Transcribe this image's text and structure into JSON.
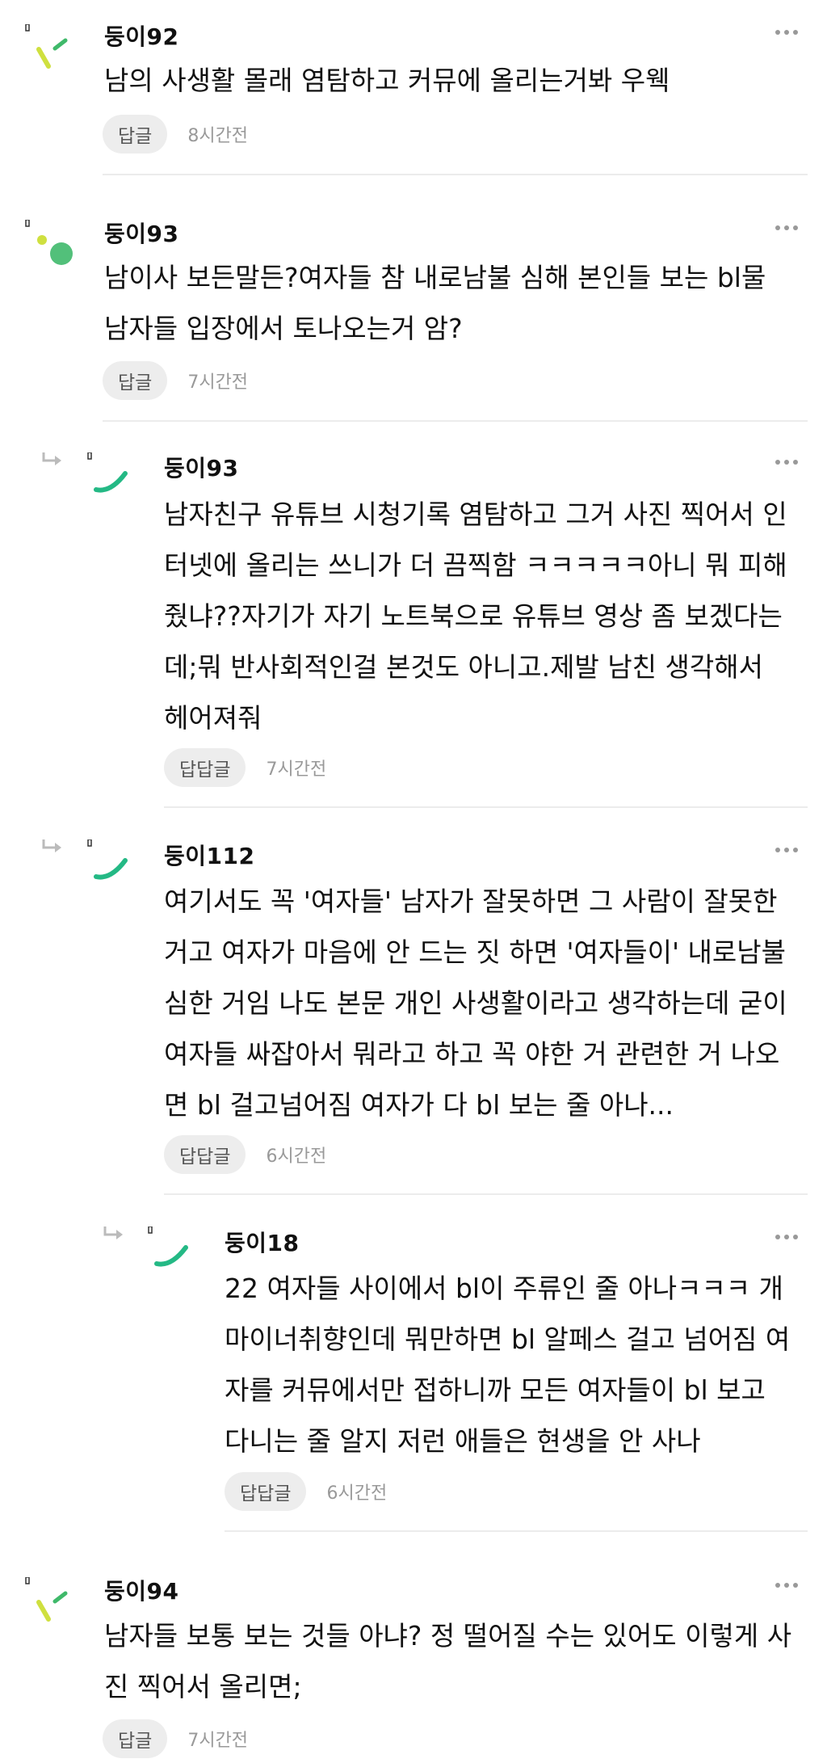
{
  "comments": [
    {
      "nickname": "둥이92",
      "text": "남의 사생활 몰래 염탐하고 커뮤에 올리는거봐 우웩",
      "reply_label": "답글",
      "time": "8시간전"
    },
    {
      "nickname": "둥이93",
      "text": "남이사 보든말든?여자들 참 내로남불 심해 본인들 보는 bl물 남자들 입장에서 토나오는거 암?",
      "reply_label": "답글",
      "time": "7시간전"
    },
    {
      "nickname": "둥이93",
      "text": "남자친구 유튜브 시청기록 염탐하고 그거 사진 찍어서 인터넷에 올리는 쓰니가 더 끔찍함 ㅋㅋㅋㅋㅋ아니 뭐 피해줬냐??자기가 자기 노트북으로 유튜브 영상 좀 보겠다는데;뭐 반사회적인걸 본것도 아니고.제발 남친 생각해서 헤어져줘",
      "reply_label": "답답글",
      "time": "7시간전"
    },
    {
      "nickname": "둥이112",
      "text": "여기서도 꼭 '여자들' 남자가 잘못하면 그 사람이 잘못한 거고 여자가 마음에 안 드는 짓 하면 '여자들이' 내로남불 심한 거임 나도 본문 개인 사생활이라고 생각하는데 굳이 여자들 싸잡아서 뭐라고 하고 꼭 야한 거 관련한 거 나오면 bl 걸고넘어짐 여자가 다 bl 보는 줄 아나...",
      "reply_label": "답답글",
      "time": "6시간전"
    },
    {
      "nickname": "둥이18",
      "text": "22 여자들 사이에서 bl이 주류인 줄 아나ㅋㅋㅋ 개 마이너취향인데 뭐만하면 bl 알페스 걸고 넘어짐 여자를 커뮤에서만 접하니까 모든 여자들이 bl 보고 다니는 줄 알지 저런 애들은 현생을 안 사나",
      "reply_label": "답답글",
      "time": "6시간전"
    },
    {
      "nickname": "둥이94",
      "text": "남자들 보통 보는 것들 아냐? 정 떨어질 수는 있어도 이렇게 사진 찍어서 올리면;",
      "reply_label": "답글",
      "time": "7시간전"
    }
  ],
  "icons": {
    "more": "more-horizontal-icon",
    "reply": "reply-arrow-icon",
    "badge": "small-badge-icon"
  },
  "colors": {
    "avatar_lime": "#cfe03f",
    "avatar_green": "#52c07a",
    "avatar_teal": "#24b985",
    "meta_gray": "#999999",
    "button_bg": "#ededed"
  }
}
